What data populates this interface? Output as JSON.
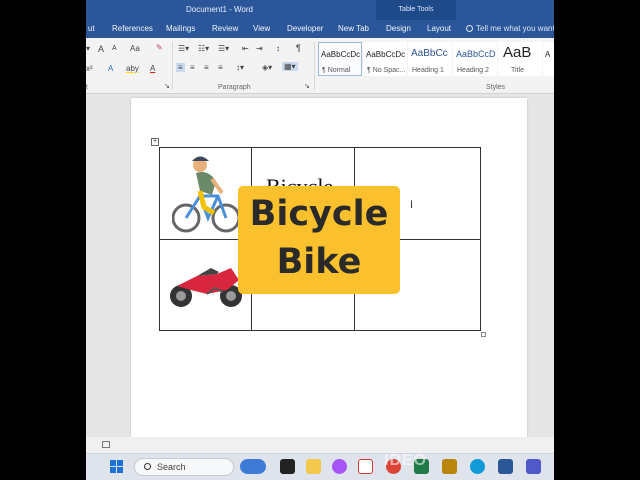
{
  "titlebar": {
    "document_title": "Document1 - Word",
    "contextual_group": "Table Tools"
  },
  "tabs": [
    "ut",
    "References",
    "Mailings",
    "Review",
    "View",
    "Developer",
    "New Tab",
    "Design",
    "Layout"
  ],
  "tell_me": "Tell me what you want",
  "ribbon": {
    "font_group": {
      "grow": "A",
      "shrink": "A",
      "change_case": "Aa",
      "superscript": "x²",
      "font_color_letter": "A",
      "highlight_letter": "aby"
    },
    "paragraph_label": "Paragraph",
    "paragraph_prefix": "t",
    "pilcrow": "¶",
    "styles_label": "Styles",
    "styles": [
      {
        "sample": "AaBbCcDc",
        "name": "¶ Normal",
        "selected": true
      },
      {
        "sample": "AaBbCcDc",
        "name": "¶ No Spac...",
        "selected": false
      },
      {
        "sample": "AaBbCc",
        "name": "Heading 1",
        "selected": false
      },
      {
        "sample": "AaBbCcD",
        "name": "Heading 2",
        "selected": false
      },
      {
        "sample": "AaB",
        "name": "Title",
        "selected": false
      },
      {
        "sample": "A",
        "name": "",
        "selected": false
      }
    ]
  },
  "document": {
    "table_move_handle": "+",
    "cell_r1c2": "Bicycle",
    "cursor": "I"
  },
  "overlay": {
    "line1": "Bicycle",
    "line2": "Bike"
  },
  "taskbar": {
    "search_placeholder": "Search"
  },
  "watermark": "IDEO",
  "colors": {
    "ribbon_blue": "#2b579a",
    "overlay_yellow": "#fbc02d",
    "style_selected_border": "#9cb9e0"
  },
  "icons": {
    "cell_r1c1": "cyclist-emoji",
    "cell_r2c1": "motorcycle-emoji",
    "taskbar_apps": [
      "widgets-icon",
      "terminal-icon",
      "file-explorer-icon",
      "copilot-icon",
      "pdf-icon",
      "chrome-icon",
      "excel-icon",
      "archive-icon",
      "edge-icon",
      "word-icon",
      "teams-icon"
    ]
  }
}
